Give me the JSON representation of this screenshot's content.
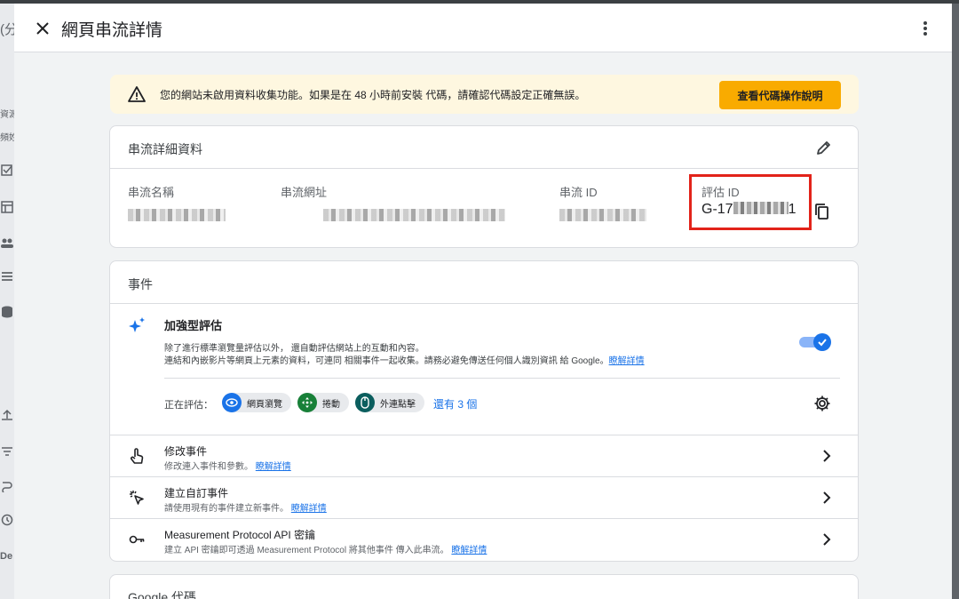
{
  "background": {
    "left_labels": [
      "(分",
      "資源",
      "頻姓",
      "De"
    ]
  },
  "header": {
    "title": "網頁串流詳情"
  },
  "banner": {
    "message": "您的網站未啟用資料收集功能。如果是在 48 小時前安裝 代碼，請確認代碼設定正確無誤。",
    "button": "查看代碼操作說明"
  },
  "stream_details": {
    "heading": "串流詳細資料",
    "fields": {
      "name_label": "串流名稱",
      "url_label": "串流網址",
      "id_label": "串流 ID",
      "measurement_label": "評估 ID",
      "measurement_prefix": "G-17",
      "measurement_suffix": "1"
    }
  },
  "events": {
    "heading": "事件",
    "enhanced": {
      "title": "加強型評估",
      "desc_line1": "除了進行標準瀏覽量評估以外， 還自動評估網站上的互動和內容。",
      "desc_line2": "連結和內嵌影片等網頁上元素的資料，可連同 相關事件一起收集。請務必避免傳送任何個人識別資訊 給 Google。",
      "learn_more": "瞭解詳情",
      "toggle_on": true,
      "measuring_label": "正在評估：",
      "chips": [
        "網頁瀏覽",
        "捲動",
        "外連點擊"
      ],
      "more_link": "還有 3 個"
    },
    "rows": [
      {
        "title": "修改事件",
        "desc": "修改連入事件和參數。",
        "link": "瞭解詳情"
      },
      {
        "title": "建立自訂事件",
        "desc": "請使用現有的事件建立新事件。",
        "link": "瞭解詳情"
      },
      {
        "title": "Measurement Protocol API 密鑰",
        "desc": "建立 API 密鑰即可透過 Measurement Protocol 將其他事件 傳入此串流。",
        "link": "瞭解詳情"
      }
    ]
  },
  "google_tag": {
    "heading": "Google 代碼"
  },
  "colors": {
    "accent": "#1a73e8",
    "cta": "#f9ab00",
    "banner_bg": "#fef7e0",
    "highlight": "#e2231a"
  }
}
